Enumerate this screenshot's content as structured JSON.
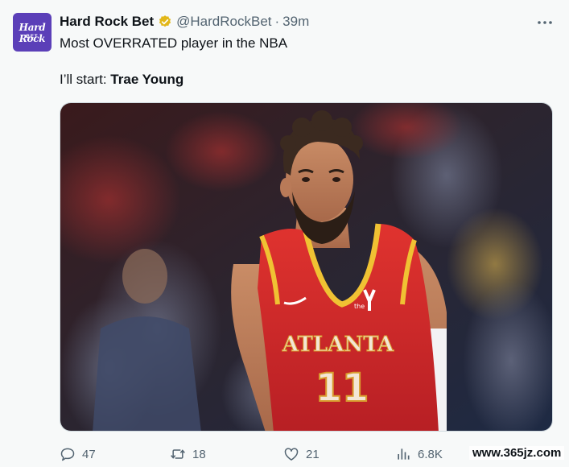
{
  "account": {
    "display_name": "Hard Rock Bet",
    "handle": "@HardRockBet",
    "separator": "·",
    "time": "39m",
    "avatar_text_top": "Hard Rock",
    "avatar_text_bottom": "BET",
    "verified_badge_color": "#e2b719"
  },
  "tweet": {
    "line1": "Most OVERRATED player in the NBA",
    "line2_prefix": "I’ll start: ",
    "line2_bold": "Trae Young"
  },
  "media": {
    "jersey_text": "ATLANTA",
    "jersey_number": "11",
    "jersey_sponsor": "the",
    "jersey_color": "#d62a2a"
  },
  "actions": {
    "replies": "47",
    "reposts": "18",
    "likes": "21",
    "views": "6.8K"
  },
  "watermark": "www.365jz.com",
  "icons": {
    "more": "more-icon",
    "reply": "reply-icon",
    "repost": "repost-icon",
    "like": "heart-icon",
    "views": "views-icon",
    "badge": "verified-badge-icon"
  }
}
